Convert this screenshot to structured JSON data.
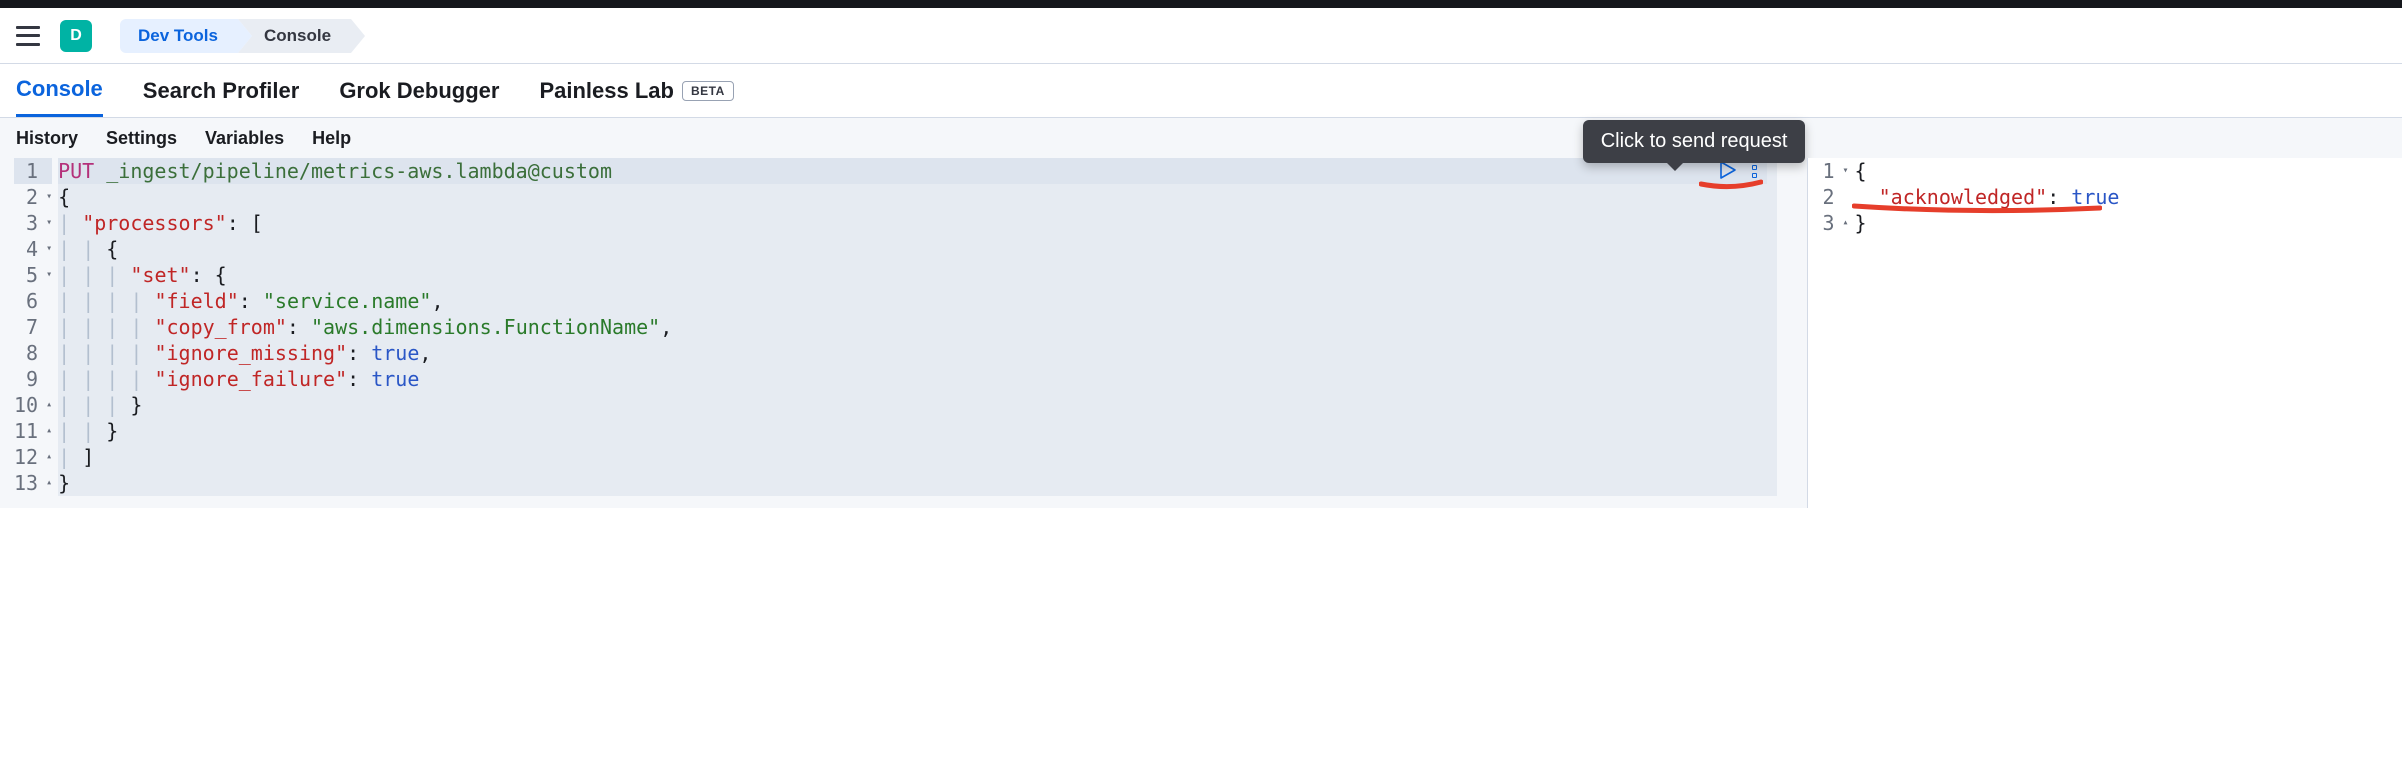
{
  "header": {
    "avatar_letter": "D",
    "breadcrumbs": [
      "Dev Tools",
      "Console"
    ]
  },
  "tabs": {
    "items": [
      "Console",
      "Search Profiler",
      "Grok Debugger",
      "Painless Lab"
    ],
    "beta_label": "BETA",
    "active_index": 0
  },
  "subnav": [
    "History",
    "Settings",
    "Variables",
    "Help"
  ],
  "tooltip": "Click to send request",
  "request": {
    "method": "PUT",
    "path": "_ingest/pipeline/metrics-aws.lambda@custom",
    "lines": [
      {
        "n": 1,
        "fold": "",
        "raw_method_path": true
      },
      {
        "n": 2,
        "fold": "▾",
        "indent": 0,
        "open": "{"
      },
      {
        "n": 3,
        "fold": "▾",
        "indent": 1,
        "key": "processors",
        "after": ": ["
      },
      {
        "n": 4,
        "fold": "▾",
        "indent": 2,
        "open": "{"
      },
      {
        "n": 5,
        "fold": "▾",
        "indent": 3,
        "key": "set",
        "after": ": {"
      },
      {
        "n": 6,
        "fold": "",
        "indent": 4,
        "key": "field",
        "str": "service.name",
        "comma": true
      },
      {
        "n": 7,
        "fold": "",
        "indent": 4,
        "key": "copy_from",
        "str": "aws.dimensions.FunctionName",
        "comma": true
      },
      {
        "n": 8,
        "fold": "",
        "indent": 4,
        "key": "ignore_missing",
        "bool": "true",
        "comma": true
      },
      {
        "n": 9,
        "fold": "",
        "indent": 4,
        "key": "ignore_failure",
        "bool": "true"
      },
      {
        "n": 10,
        "fold": "▴",
        "indent": 3,
        "close": "}"
      },
      {
        "n": 11,
        "fold": "▴",
        "indent": 2,
        "close": "}"
      },
      {
        "n": 12,
        "fold": "▴",
        "indent": 1,
        "close": "]"
      },
      {
        "n": 13,
        "fold": "▴",
        "indent": 0,
        "close": "}"
      }
    ]
  },
  "response": {
    "lines": [
      {
        "n": 1,
        "fold": "▾",
        "open": "{"
      },
      {
        "n": 2,
        "fold": "",
        "indent": 1,
        "key": "acknowledged",
        "bool": "true"
      },
      {
        "n": 3,
        "fold": "▴",
        "close": "}"
      }
    ]
  }
}
